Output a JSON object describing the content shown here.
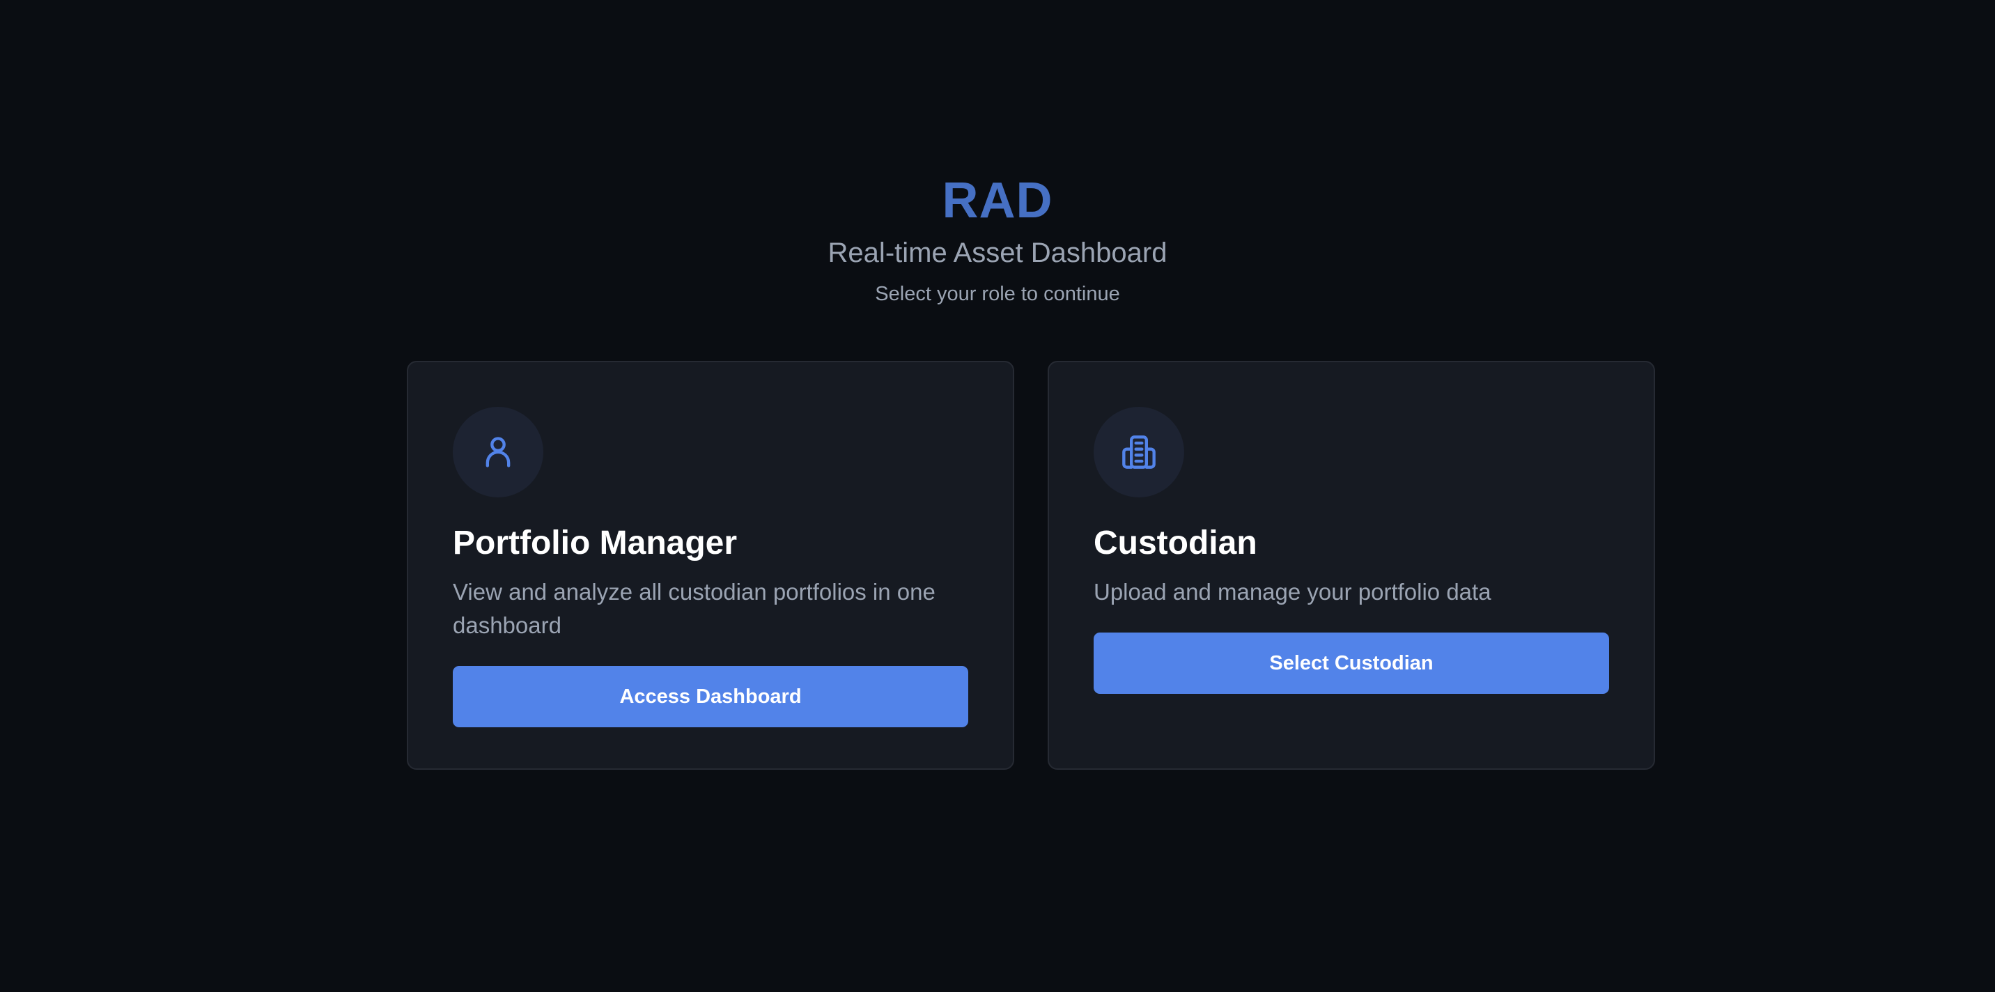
{
  "header": {
    "brand": "RAD",
    "subtitle": "Real-time Asset Dashboard",
    "prompt": "Select your role to continue"
  },
  "roles": [
    {
      "icon": "user-icon",
      "title": "Portfolio Manager",
      "description": "View and analyze all custodian portfolios in one dashboard",
      "button_label": "Access Dashboard"
    },
    {
      "icon": "building-icon",
      "title": "Custodian",
      "description": "Upload and manage your portfolio data",
      "button_label": "Select Custodian"
    }
  ],
  "colors": {
    "background": "#0a0d12",
    "card": "#161a22",
    "accent": "#5283e9",
    "brand": "#4670c4",
    "muted_text": "#9ba4b3"
  }
}
